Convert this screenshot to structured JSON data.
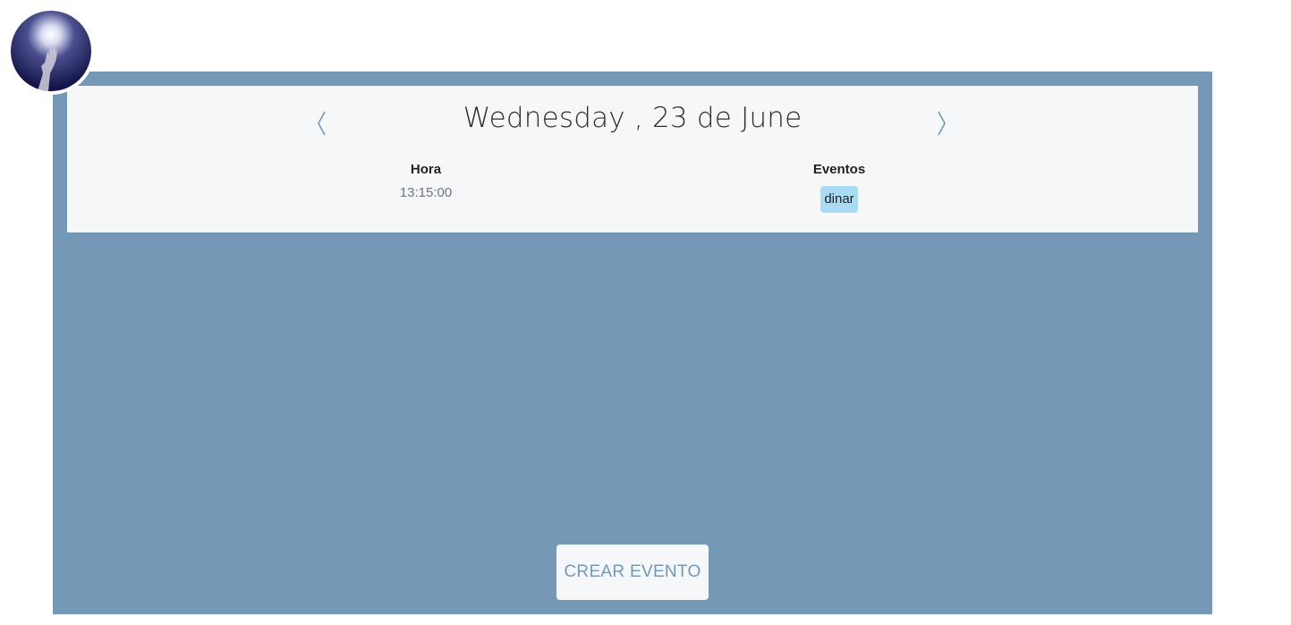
{
  "header": {
    "avatar_icon": "hand-reaching-light-avatar"
  },
  "day_view": {
    "date_title": "Wednesday , 23 de June",
    "prev_icon": "chevron-left-icon",
    "next_icon": "chevron-right-icon",
    "columns": {
      "hora": "Hora",
      "eventos": "Eventos"
    },
    "entries": [
      {
        "time": "13:15:00",
        "event": "dinar"
      }
    ]
  },
  "actions": {
    "create_label": "CREAR EVENTO"
  },
  "colors": {
    "panel": "#7598b6",
    "card": "#f6f7f9",
    "badge": "#a9dcf3",
    "accent_text": "#7598b6"
  }
}
